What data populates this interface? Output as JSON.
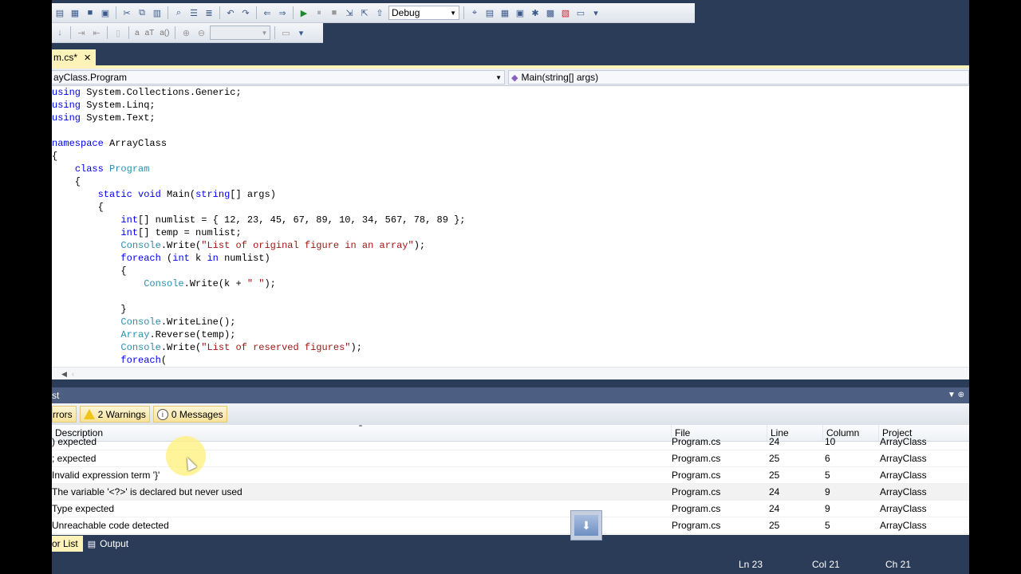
{
  "toolbar": {
    "configuration": "Debug"
  },
  "document_tab": {
    "label": "m.cs*",
    "close": "✕"
  },
  "navigation": {
    "type_combo": "ayClass.Program",
    "member_combo": "Main(string[] args)"
  },
  "code_lines": [
    [
      {
        "t": "using",
        "c": "kw"
      },
      {
        "t": " System.Collections.Generic;"
      }
    ],
    [
      {
        "t": "using",
        "c": "kw"
      },
      {
        "t": " System.Linq;"
      }
    ],
    [
      {
        "t": "using",
        "c": "kw"
      },
      {
        "t": " System.Text;"
      }
    ],
    [],
    [
      {
        "t": "namespace",
        "c": "kw"
      },
      {
        "t": " ArrayClass"
      }
    ],
    [
      {
        "t": "{"
      }
    ],
    [
      {
        "t": "    "
      },
      {
        "t": "class",
        "c": "kw"
      },
      {
        "t": " "
      },
      {
        "t": "Program",
        "c": "ty"
      }
    ],
    [
      {
        "t": "    {"
      }
    ],
    [
      {
        "t": "        "
      },
      {
        "t": "static",
        "c": "kw"
      },
      {
        "t": " "
      },
      {
        "t": "void",
        "c": "kw"
      },
      {
        "t": " Main("
      },
      {
        "t": "string",
        "c": "kw"
      },
      {
        "t": "[] args)"
      }
    ],
    [
      {
        "t": "        {"
      }
    ],
    [
      {
        "t": "            "
      },
      {
        "t": "int",
        "c": "kw"
      },
      {
        "t": "[] numlist = { 12, 23, 45, 67, 89, 10, 34, 567, 78, 89 };"
      }
    ],
    [
      {
        "t": "            "
      },
      {
        "t": "int",
        "c": "kw"
      },
      {
        "t": "[] temp = numlist;"
      }
    ],
    [
      {
        "t": "            "
      },
      {
        "t": "Console",
        "c": "ty"
      },
      {
        "t": ".Write("
      },
      {
        "t": "\"List of original figure in an array\"",
        "c": "st"
      },
      {
        "t": ");"
      }
    ],
    [
      {
        "t": "            "
      },
      {
        "t": "foreach",
        "c": "kw"
      },
      {
        "t": " ("
      },
      {
        "t": "int",
        "c": "kw"
      },
      {
        "t": " k "
      },
      {
        "t": "in",
        "c": "kw"
      },
      {
        "t": " numlist)"
      }
    ],
    [
      {
        "t": "            {"
      }
    ],
    [
      {
        "t": "                "
      },
      {
        "t": "Console",
        "c": "ty"
      },
      {
        "t": ".Write(k + "
      },
      {
        "t": "\" \"",
        "c": "st"
      },
      {
        "t": ");"
      }
    ],
    [],
    [
      {
        "t": "            }"
      }
    ],
    [
      {
        "t": "            "
      },
      {
        "t": "Console",
        "c": "ty"
      },
      {
        "t": ".WriteLine();"
      }
    ],
    [
      {
        "t": "            "
      },
      {
        "t": "Array",
        "c": "ty"
      },
      {
        "t": ".Reverse(temp);"
      }
    ],
    [
      {
        "t": "            "
      },
      {
        "t": "Console",
        "c": "ty"
      },
      {
        "t": ".Write("
      },
      {
        "t": "\"List of reserved figures\"",
        "c": "st"
      },
      {
        "t": ");"
      }
    ],
    [
      {
        "t": "            "
      },
      {
        "t": "foreach",
        "c": "kw"
      },
      {
        "t": "("
      }
    ]
  ],
  "error_list": {
    "title": "st",
    "errors_filter": "rrors",
    "warnings_filter": "2 Warnings",
    "messages_filter": "0 Messages",
    "columns": {
      "description": "Description",
      "file": "File",
      "line": "Line",
      "column": "Column",
      "project": "Project"
    },
    "rows": [
      {
        "description": ") expected",
        "file": "Program.cs",
        "line": "24",
        "column": "10",
        "project": "ArrayClass"
      },
      {
        "description": "; expected",
        "file": "Program.cs",
        "line": "25",
        "column": "6",
        "project": "ArrayClass"
      },
      {
        "description": "Invalid expression term '}'",
        "file": "Program.cs",
        "line": "25",
        "column": "5",
        "project": "ArrayClass"
      },
      {
        "description": "The variable '<?>' is declared but never used",
        "file": "Program.cs",
        "line": "24",
        "column": "9",
        "project": "ArrayClass"
      },
      {
        "description": "Type expected",
        "file": "Program.cs",
        "line": "24",
        "column": "9",
        "project": "ArrayClass"
      },
      {
        "description": "Unreachable code detected",
        "file": "Program.cs",
        "line": "25",
        "column": "5",
        "project": "ArrayClass"
      }
    ]
  },
  "bottom_tabs": {
    "error_list": "or List",
    "output": "Output"
  },
  "status_bar": {
    "ln": "Ln 23",
    "col": "Col 21",
    "ch": "Ch 21"
  }
}
